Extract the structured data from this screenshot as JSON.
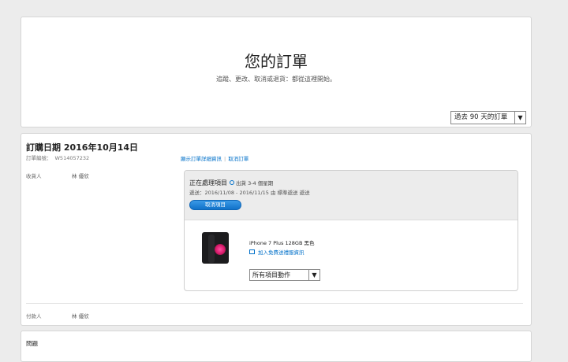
{
  "header": {
    "title": "您的訂單",
    "subtitle": "追蹤、更改、取消或退貨：都從這裡開始。",
    "period_select": "過去 90 天的訂單"
  },
  "order": {
    "date": "訂購日期 2016年10月14日",
    "number_label": "訂單編號：",
    "number": "W514057232",
    "links": {
      "show_details": "顯示訂單詳細資訊",
      "cancel_order": "取消訂單"
    },
    "recipient_label": "收貨人",
    "recipient_name": "林 優欣",
    "shipment": {
      "status": "正在處理項目",
      "status_sub": "出貨 3-4 個星期",
      "delivery": "遞送：2016/11/08 - 2016/11/15 由 標準遞送 遞送",
      "cancel_button": "取消項目",
      "product_name": "iPhone 7 Plus 128GB 黑色",
      "gift_link": "加入免費送禮服資訊",
      "actions_select": "所有項目動作"
    },
    "payer_label": "付款人",
    "payer_name": "林 優欣"
  },
  "issues": {
    "title": "問題"
  },
  "colors": {
    "link": "#0070c9",
    "button": "#1172c9",
    "background": "#ececec"
  }
}
